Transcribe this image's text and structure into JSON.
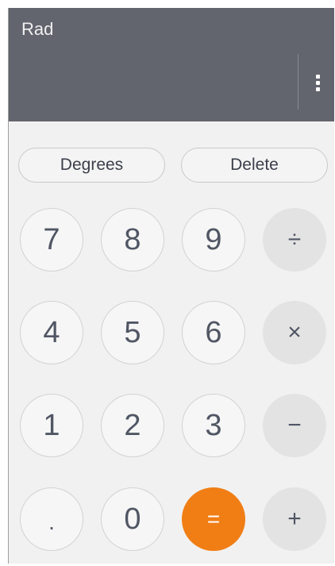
{
  "display": {
    "mode": "Rad",
    "menu_icon": "overflow-menu-icon"
  },
  "controls": {
    "degrees_label": "Degrees",
    "delete_label": "Delete"
  },
  "keypad": {
    "k7": "7",
    "k8": "8",
    "k9": "9",
    "divide": "÷",
    "k4": "4",
    "k5": "5",
    "k6": "6",
    "multiply": "×",
    "k1": "1",
    "k2": "2",
    "k3": "3",
    "minus": "−",
    "dot": ".",
    "k0": "0",
    "equals": "=",
    "plus": "+"
  },
  "colors": {
    "display_bg": "#62646e",
    "pad_bg": "#f1f1f1",
    "equals_accent": "#f07e15",
    "operator_bg": "#e3e3e3"
  }
}
